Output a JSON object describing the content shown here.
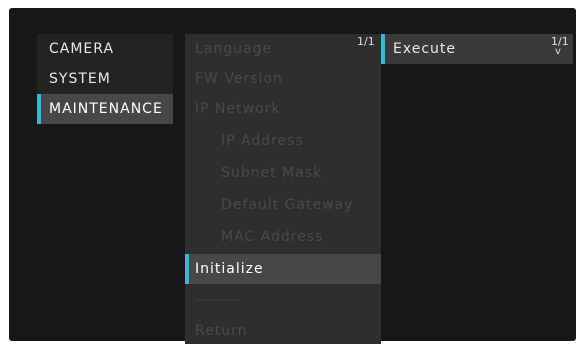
{
  "main_menu": {
    "items": [
      {
        "label": "CAMERA"
      },
      {
        "label": "SYSTEM"
      },
      {
        "label": "MAINTENANCE"
      }
    ],
    "selected": "MAINTENANCE"
  },
  "maintenance_menu": {
    "page_indicator": "1/1",
    "items": [
      {
        "label": "Language"
      },
      {
        "label": "FW Version"
      },
      {
        "label": "IP Network"
      },
      {
        "label": "IP Address"
      },
      {
        "label": "Subnet Mask"
      },
      {
        "label": "Default Gateway"
      },
      {
        "label": "MAC Address"
      },
      {
        "label": "Initialize"
      },
      {
        "label": "------------"
      },
      {
        "label": "Return"
      }
    ],
    "selected": "Initialize"
  },
  "initialize_menu": {
    "page_indicator": "1/1",
    "scroll_glyph": "v",
    "items": [
      {
        "label": "Execute"
      }
    ]
  },
  "colors": {
    "accent": "#35b9d6",
    "selected_bg": "#474747",
    "panel_bg": "#2e2e2e",
    "screen_bg": "#171717",
    "dim_text": "#4a4a4a"
  }
}
